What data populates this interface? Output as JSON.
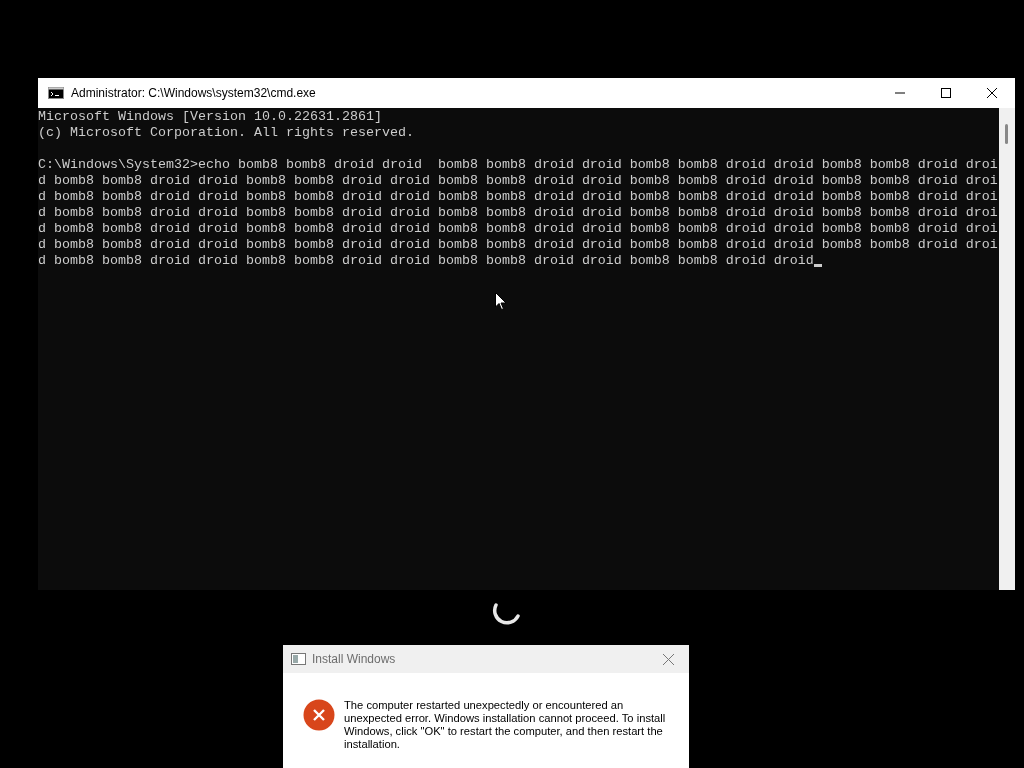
{
  "cmd_window": {
    "title": "Administrator: C:\\Windows\\system32\\cmd.exe",
    "banner": [
      "Microsoft Windows [Version 10.0.22631.2861]",
      "(c) Microsoft Corporation. All rights reserved."
    ],
    "command_lines": [
      "C:\\Windows\\System32>echo bomb8 bomb8 droid droid  bomb8 bomb8 droid droid bomb8 bomb8 droid droid bomb8 bomb8 droid droi",
      "d bomb8 bomb8 droid droid bomb8 bomb8 droid droid bomb8 bomb8 droid droid bomb8 bomb8 droid droid bomb8 bomb8 droid droi",
      "d bomb8 bomb8 droid droid bomb8 bomb8 droid droid bomb8 bomb8 droid droid bomb8 bomb8 droid droid bomb8 bomb8 droid droi",
      "d bomb8 bomb8 droid droid bomb8 bomb8 droid droid bomb8 bomb8 droid droid bomb8 bomb8 droid droid bomb8 bomb8 droid droi",
      "d bomb8 bomb8 droid droid bomb8 bomb8 droid droid bomb8 bomb8 droid droid bomb8 bomb8 droid droid bomb8 bomb8 droid droi",
      "d bomb8 bomb8 droid droid bomb8 bomb8 droid droid bomb8 bomb8 droid droid bomb8 bomb8 droid droid bomb8 bomb8 droid droi",
      "d bomb8 bomb8 droid droid bomb8 bomb8 droid droid bomb8 bomb8 droid droid bomb8 bomb8 droid droid"
    ]
  },
  "dialog": {
    "title": "Install Windows",
    "message": "The computer restarted unexpectedly or encountered an unexpected error. Windows installation cannot proceed. To install Windows, click \"OK\" to restart the computer, and then restart the installation."
  }
}
